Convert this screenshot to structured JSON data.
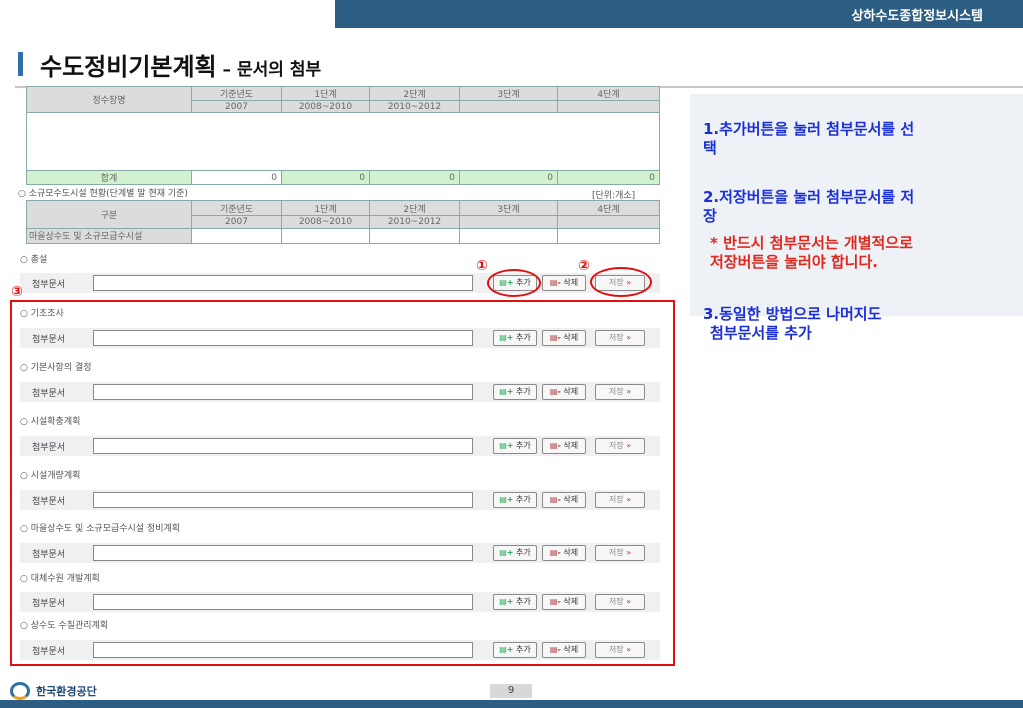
{
  "header": {
    "system_title": "상하수도종합정보시스템"
  },
  "slide": {
    "title": "수도정비기본계획",
    "dash": " – ",
    "subtitle": "문서의 첨부",
    "page_number": "9"
  },
  "org": {
    "logo_text": "한국환경공단"
  },
  "instructions": {
    "step1_line1": "1.추가버튼을 눌러 첨부문서를 선",
    "step1_line2": "택",
    "step2_line1": "2.저장버튼을 눌러 첨부문서를 저",
    "step2_line2": "장",
    "step2_note1": "* 반드시 첨부문서는 개별적으로",
    "step2_note2": "저장버튼을 눌러야 합니다.",
    "step3_line1": "3.동일한 방법으로 나머지도",
    "step3_line2": "첨부문서를 추가"
  },
  "table1": {
    "headers": [
      "정수장명",
      "기준년도",
      "1단계",
      "2단계",
      "3단계",
      "4단계"
    ],
    "subheaders": [
      "2007",
      "2008~2010",
      "2010~2012"
    ],
    "total_label": "합계",
    "total_values": [
      "0",
      "0",
      "0",
      "0",
      "0"
    ]
  },
  "section_small": {
    "label": "○ 소규모수도시설 현황(단계별 말 현재 기준)",
    "unit": "[단위:개소]"
  },
  "table2": {
    "headers": [
      "구분",
      "기준년도",
      "1단계",
      "2단계",
      "3단계",
      "4단계"
    ],
    "subheaders": [
      "2007",
      "2008~2010",
      "2010~2012"
    ],
    "row_label": "마을상수도 및 소규모급수시설"
  },
  "attach": {
    "label": "첨부문서",
    "add": "추가",
    "delete": "삭제",
    "save": "저장",
    "sections": [
      "○ 총설",
      "○ 기초조사",
      "○ 기본사항의 결정",
      "○ 시설확충계획",
      "○ 시설개량계획",
      "○ 마을상수도 및 소규모급수시설 정비계획",
      "○ 대체수원 개발계획",
      "○ 상수도 수질관리계획"
    ]
  },
  "markers": {
    "m1": "①",
    "m2": "②",
    "m3": "③"
  }
}
